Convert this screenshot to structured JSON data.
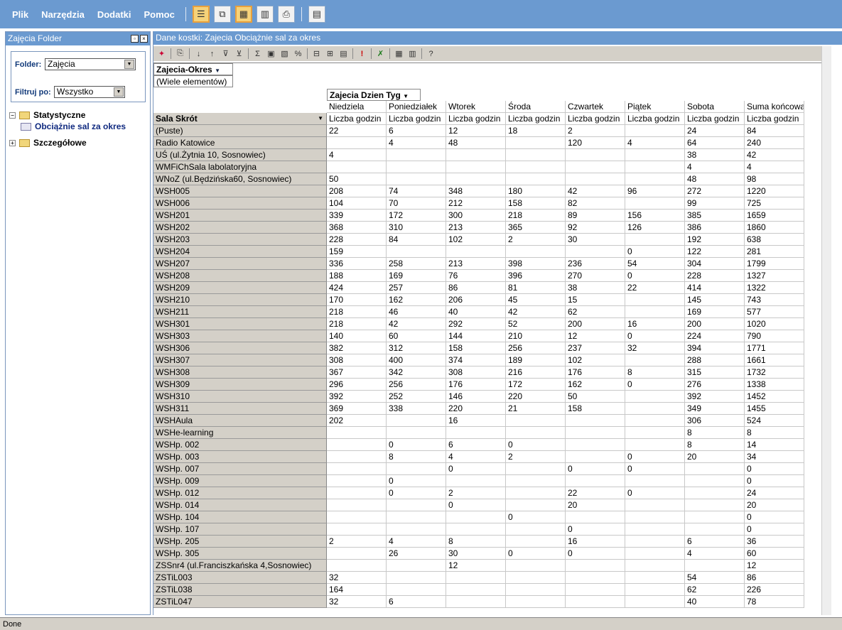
{
  "menu": {
    "items": [
      "Plik",
      "Narzędzia",
      "Dodatki",
      "Pomoc"
    ]
  },
  "left_panel": {
    "title": "Zajęcia Folder",
    "folder_label": "Folder:",
    "folder_value": "Zajęcia",
    "filter_label": "Filtruj po:",
    "filter_value": "Wszystko",
    "tree": {
      "node1": "Statystyczne",
      "node1_child": "Obciążnie sal za okres",
      "node2": "Szczegółowe"
    }
  },
  "right_panel": {
    "title": "Dane kostki: Zajecia Obciążnie sal za okres"
  },
  "pivot": {
    "filter_field": "Zajecia-Okres",
    "filter_value": "(Wiele elementów)",
    "column_field": "Zajecia Dzien Tyg",
    "row_field": "Sala Skrót",
    "columns": [
      "Niedziela",
      "Poniedziałek",
      "Wtorek",
      "Środa",
      "Czwartek",
      "Piątek",
      "Sobota",
      "Suma końcowa"
    ],
    "measure": "Liczba godzin",
    "rows": [
      {
        "label": "(Puste)",
        "values": [
          "22",
          "6",
          "12",
          "18",
          "2",
          "",
          "24",
          "84"
        ]
      },
      {
        "label": "Radio Katowice",
        "values": [
          "",
          "4",
          "48",
          "",
          "120",
          "4",
          "64",
          "240"
        ]
      },
      {
        "label": "UŚ  (ul.Żytnia 10, Sosnowiec)",
        "values": [
          "4",
          "",
          "",
          "",
          "",
          "",
          "38",
          "42"
        ]
      },
      {
        "label": "WMFiChSala labolatoryjna",
        "values": [
          "",
          "",
          "",
          "",
          "",
          "",
          "4",
          "4"
        ]
      },
      {
        "label": "WNoZ (ul.Będzińska60, Sosnowiec)",
        "values": [
          "50",
          "",
          "",
          "",
          "",
          "",
          "48",
          "98"
        ]
      },
      {
        "label": "WSH005",
        "values": [
          "208",
          "74",
          "348",
          "180",
          "42",
          "96",
          "272",
          "1220"
        ]
      },
      {
        "label": "WSH006",
        "values": [
          "104",
          "70",
          "212",
          "158",
          "82",
          "",
          "99",
          "725"
        ]
      },
      {
        "label": "WSH201",
        "values": [
          "339",
          "172",
          "300",
          "218",
          "89",
          "156",
          "385",
          "1659"
        ]
      },
      {
        "label": "WSH202",
        "values": [
          "368",
          "310",
          "213",
          "365",
          "92",
          "126",
          "386",
          "1860"
        ]
      },
      {
        "label": "WSH203",
        "values": [
          "228",
          "84",
          "102",
          "2",
          "30",
          "",
          "192",
          "638"
        ]
      },
      {
        "label": "WSH204",
        "values": [
          "159",
          "",
          "",
          "",
          "",
          "0",
          "122",
          "281"
        ]
      },
      {
        "label": "WSH207",
        "values": [
          "336",
          "258",
          "213",
          "398",
          "236",
          "54",
          "304",
          "1799"
        ]
      },
      {
        "label": "WSH208",
        "values": [
          "188",
          "169",
          "76",
          "396",
          "270",
          "0",
          "228",
          "1327"
        ]
      },
      {
        "label": "WSH209",
        "values": [
          "424",
          "257",
          "86",
          "81",
          "38",
          "22",
          "414",
          "1322"
        ]
      },
      {
        "label": "WSH210",
        "values": [
          "170",
          "162",
          "206",
          "45",
          "15",
          "",
          "145",
          "743"
        ]
      },
      {
        "label": "WSH211",
        "values": [
          "218",
          "46",
          "40",
          "42",
          "62",
          "",
          "169",
          "577"
        ]
      },
      {
        "label": "WSH301",
        "values": [
          "218",
          "42",
          "292",
          "52",
          "200",
          "16",
          "200",
          "1020"
        ]
      },
      {
        "label": "WSH303",
        "values": [
          "140",
          "60",
          "144",
          "210",
          "12",
          "0",
          "224",
          "790"
        ]
      },
      {
        "label": "WSH306",
        "values": [
          "382",
          "312",
          "158",
          "256",
          "237",
          "32",
          "394",
          "1771"
        ]
      },
      {
        "label": "WSH307",
        "values": [
          "308",
          "400",
          "374",
          "189",
          "102",
          "",
          "288",
          "1661"
        ]
      },
      {
        "label": "WSH308",
        "values": [
          "367",
          "342",
          "308",
          "216",
          "176",
          "8",
          "315",
          "1732"
        ]
      },
      {
        "label": "WSH309",
        "values": [
          "296",
          "256",
          "176",
          "172",
          "162",
          "0",
          "276",
          "1338"
        ]
      },
      {
        "label": "WSH310",
        "values": [
          "392",
          "252",
          "146",
          "220",
          "50",
          "",
          "392",
          "1452"
        ]
      },
      {
        "label": "WSH311",
        "values": [
          "369",
          "338",
          "220",
          "21",
          "158",
          "",
          "349",
          "1455"
        ]
      },
      {
        "label": "WSHAula",
        "values": [
          "202",
          "",
          "16",
          "",
          "",
          "",
          "306",
          "524"
        ]
      },
      {
        "label": "WSHe-learning",
        "values": [
          "",
          "",
          "",
          "",
          "",
          "",
          "8",
          "8"
        ]
      },
      {
        "label": "WSHp. 002",
        "values": [
          "",
          "0",
          "6",
          "0",
          "",
          "",
          "8",
          "14"
        ]
      },
      {
        "label": "WSHp. 003",
        "values": [
          "",
          "8",
          "4",
          "2",
          "",
          "0",
          "20",
          "34"
        ]
      },
      {
        "label": "WSHp. 007",
        "values": [
          "",
          "",
          "0",
          "",
          "0",
          "0",
          "",
          "0"
        ]
      },
      {
        "label": "WSHp. 009",
        "values": [
          "",
          "0",
          "",
          "",
          "",
          "",
          "",
          "0"
        ]
      },
      {
        "label": "WSHp. 012",
        "values": [
          "",
          "0",
          "2",
          "",
          "22",
          "0",
          "",
          "24"
        ]
      },
      {
        "label": "WSHp. 014",
        "values": [
          "",
          "",
          "0",
          "",
          "20",
          "",
          "",
          "20"
        ]
      },
      {
        "label": "WSHp. 104",
        "values": [
          "",
          "",
          "",
          "0",
          "",
          "",
          "",
          "0"
        ]
      },
      {
        "label": "WSHp. 107",
        "values": [
          "",
          "",
          "",
          "",
          "0",
          "",
          "",
          "0"
        ]
      },
      {
        "label": "WSHp. 205",
        "values": [
          "2",
          "4",
          "8",
          "",
          "16",
          "",
          "6",
          "36"
        ]
      },
      {
        "label": "WSHp. 305",
        "values": [
          "",
          "26",
          "30",
          "0",
          "0",
          "",
          "4",
          "60"
        ]
      },
      {
        "label": "ZSSnr4 (ul.Franciszkańska 4,Sosnowiec)",
        "values": [
          "",
          "",
          "12",
          "",
          "",
          "",
          "",
          "12"
        ]
      },
      {
        "label": "ZSTiL003",
        "values": [
          "32",
          "",
          "",
          "",
          "",
          "",
          "54",
          "86"
        ]
      },
      {
        "label": "ZSTiL038",
        "values": [
          "164",
          "",
          "",
          "",
          "",
          "",
          "62",
          "226"
        ]
      },
      {
        "label": "ZSTiL047",
        "values": [
          "32",
          "6",
          "",
          "",
          "",
          "",
          "40",
          "78"
        ]
      }
    ]
  },
  "status": {
    "text": "Done"
  }
}
